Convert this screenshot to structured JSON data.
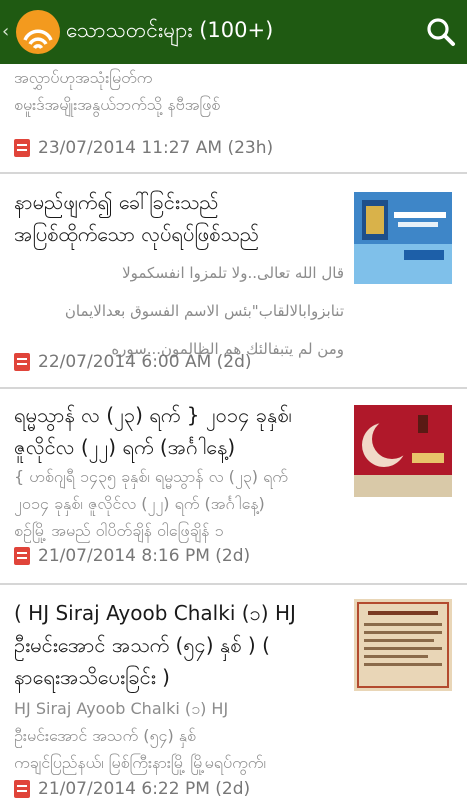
{
  "header": {
    "back_glyph": "‹",
    "title": "သောသတင်းများ (100+)",
    "icons": {
      "app": "wifi-app-logo-icon",
      "search": "search-icon"
    },
    "colors": {
      "bar": "#1f5a12",
      "logo": "#f39a1e"
    }
  },
  "articles": [
    {
      "title": "",
      "snippet": "အလွှာပ်ဟုအသုံးမြတ်က\nစမူးဒ်အမျိုးအနွယ်ဘက်သို့ နဗီအဖြစ်",
      "date": "23/07/2014 11:27 AM (23h)"
    },
    {
      "title": "နာမည်ဖျက်၍ ခေါ်ခြင်းသည်\nအပြစ်ထိုက်သော လုပ်ရပ်ဖြစ်သည်",
      "snippet": "قال الله تعالى..ولا تلمزوا انفسكمولا\nتنابزوابالالقاب\"بئس الاسم الفسوق بعدالايمان\nومن لم يتبفالئك هم الظالمون...سوره",
      "date": "22/07/2014 6:00 AM (2d)"
    },
    {
      "title": "ရမ္မသွာန် လ (၂၃) ရက် } ၂၀၁၄ ခုနှစ်၊\nဇူလိုင်လ (၂၂) ရက် (အင်္ဂါနေ့)",
      "snippet": "{ ဟစ်ဂျရီ ၁၄၃၅ ခုနှစ်၊ ရမ္မသွာန် လ (၂၃) ရက်\n၂၀၁၄ ခုနှစ်၊ ဇူလိုင်လ (၂၂) ရက် (အင်္ဂါနေ့)\nစဉ်မြို့ အမည် ဝါပိတ်ချိန် ဝါဖြေချိန် ၁",
      "date": "21/07/2014 8:16 PM (2d)"
    },
    {
      "title": "( HJ Siraj Ayoob Chalki (၁) HJ\nဦးမင်းအောင် အသက် (၅၄) နှစ် ) (\nနာရေးအသိပေးခြင်း )",
      "snippet": "HJ Siraj Ayoob Chalki (၁) HJ\nဦးမင်းအောင် အသက် (၅၄) နှစ်\nကချင်ပြည်နယ်၊ မြစ်ကြီးနားမြို့ မြို့မရပ်ကွက်၊",
      "date": "21/07/2014 6:22 PM (2d)"
    }
  ],
  "doc_icon": "document-icon",
  "accent": {
    "doc_icon": "#e0443a",
    "divider": "#d6d6d6"
  }
}
